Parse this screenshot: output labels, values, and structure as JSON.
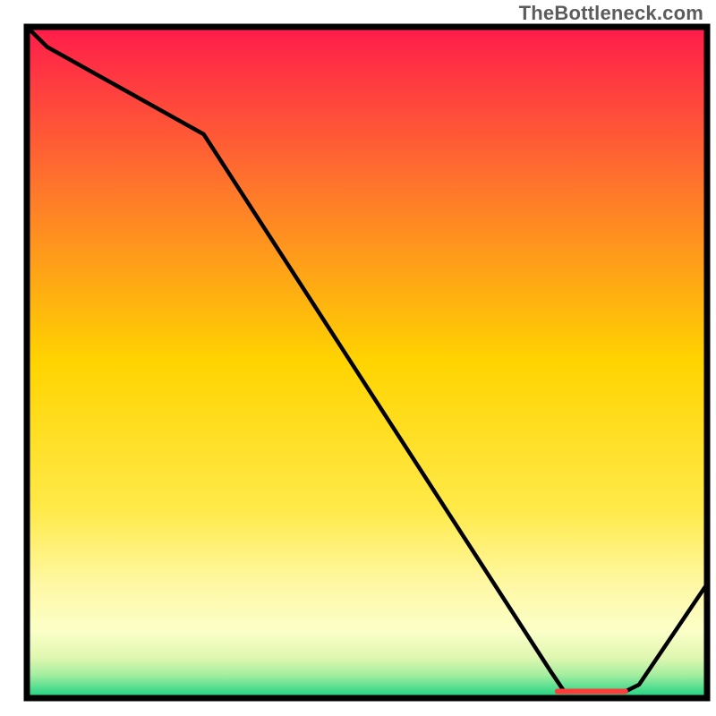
{
  "attribution": "TheBottleneck.com",
  "chart_data": {
    "type": "line",
    "title": "",
    "xlabel": "",
    "ylabel": "",
    "xlim": [
      0,
      100
    ],
    "ylim": [
      0,
      100
    ],
    "x": [
      0,
      3,
      26,
      77,
      79,
      88,
      90,
      100
    ],
    "values": [
      100,
      97,
      84,
      4,
      1,
      1,
      2,
      17
    ],
    "marker_segment": {
      "x_start": 78,
      "x_end": 88,
      "y": 1
    },
    "gradient_stops": [
      {
        "offset": 0.0,
        "color": "#ff1c4b"
      },
      {
        "offset": 0.25,
        "color": "#ff7a2a"
      },
      {
        "offset": 0.5,
        "color": "#ffd400"
      },
      {
        "offset": 0.72,
        "color": "#ffea4a"
      },
      {
        "offset": 0.83,
        "color": "#fff8a4"
      },
      {
        "offset": 0.9,
        "color": "#fbffc8"
      },
      {
        "offset": 0.94,
        "color": "#dff7b0"
      },
      {
        "offset": 0.965,
        "color": "#a6eea0"
      },
      {
        "offset": 0.99,
        "color": "#3fd98b"
      },
      {
        "offset": 1.0,
        "color": "#1fcf7e"
      }
    ],
    "colors": {
      "line": "#000000",
      "marker": "#ff3b3b",
      "frame": "#000000"
    }
  }
}
